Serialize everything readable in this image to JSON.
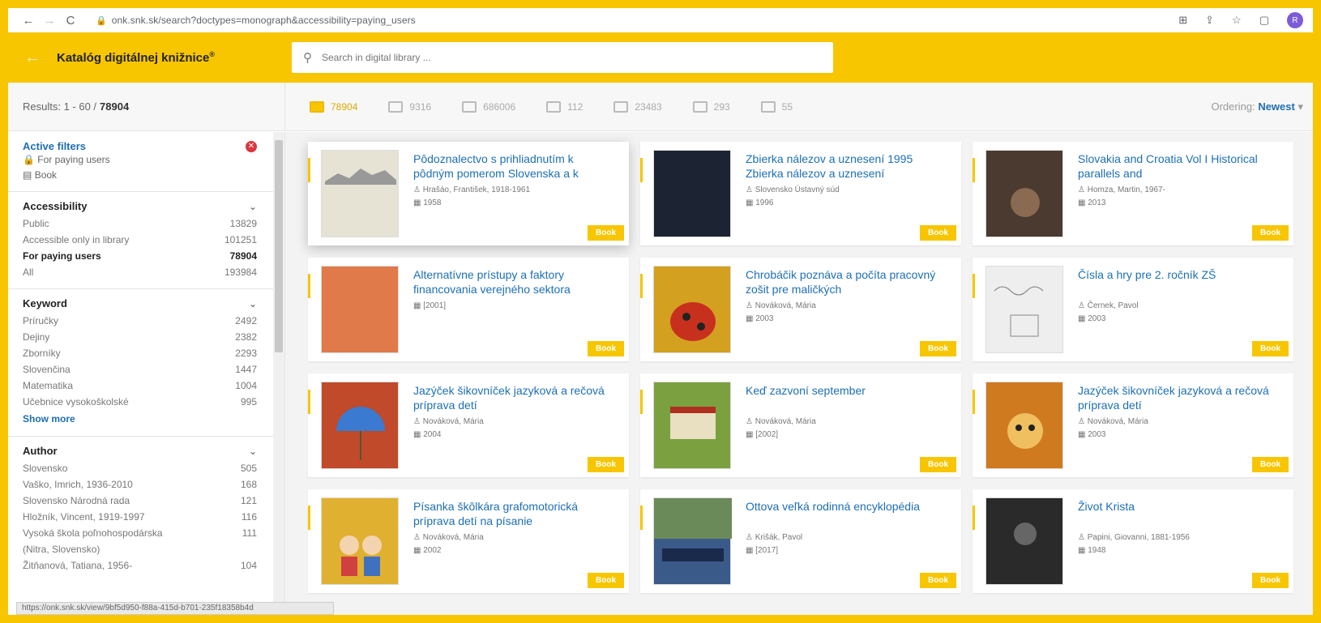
{
  "browser": {
    "url": "onk.snk.sk/search?doctypes=monograph&accessibility=paying_users",
    "avatar": "R",
    "back": "←",
    "forward": "→",
    "reload": "C"
  },
  "header": {
    "title": "Katalóg digitálnej knižnice",
    "sup": "®",
    "search_placeholder": "Search in digital library ..."
  },
  "results": {
    "label": "Results: 1 - 60 /",
    "total": "78904"
  },
  "doctabs": [
    {
      "count": "78904",
      "icon": "book-icon"
    },
    {
      "count": "9316",
      "icon": "periodical-icon"
    },
    {
      "count": "686006",
      "icon": "article-icon"
    },
    {
      "count": "112",
      "icon": "map-icon"
    },
    {
      "count": "23483",
      "icon": "graphic-icon"
    },
    {
      "count": "293",
      "icon": "manuscript-icon"
    },
    {
      "count": "55",
      "icon": "music-icon"
    }
  ],
  "ordering": {
    "label": "Ordering:",
    "value": "Newest"
  },
  "filters": {
    "active": {
      "title": "Active filters",
      "items": [
        "For paying users",
        "Book"
      ]
    },
    "accessibility": {
      "title": "Accessibility",
      "items": [
        {
          "label": "Public",
          "count": "13829"
        },
        {
          "label": "Accessible only in library",
          "count": "101251"
        },
        {
          "label": "For paying users",
          "count": "78904"
        },
        {
          "label": "All",
          "count": "193984"
        }
      ]
    },
    "keyword": {
      "title": "Keyword",
      "items": [
        {
          "label": "Príručky",
          "count": "2492"
        },
        {
          "label": "Dejiny",
          "count": "2382"
        },
        {
          "label": "Zborníky",
          "count": "2293"
        },
        {
          "label": "Slovenčina",
          "count": "1447"
        },
        {
          "label": "Matematika",
          "count": "1004"
        },
        {
          "label": "Učebnice vysokoškolské",
          "count": "995"
        }
      ],
      "show_more": "Show more"
    },
    "author": {
      "title": "Author",
      "items": [
        {
          "label": "Slovensko",
          "count": "505"
        },
        {
          "label": "Vaško, Imrich, 1936-2010",
          "count": "168"
        },
        {
          "label": "Slovensko Národná rada",
          "count": "121"
        },
        {
          "label": "Hložník, Vincent, 1919-1997",
          "count": "116"
        },
        {
          "label": "Vysoká škola poľnohospodárska",
          "count": "111"
        },
        {
          "label": "(Nitra, Slovensko)",
          "count": ""
        },
        {
          "label": "Žitňanová, Tatiana, 1956-",
          "count": "104"
        }
      ]
    }
  },
  "cards": [
    {
      "title": "Pôdoznalectvo s prihliadnutím k pôdným pomerom Slovenska a k",
      "author": "Hrašáo, František, 1918-1961",
      "year": "1958",
      "badge": "Book",
      "thumb": "#d8d4c6"
    },
    {
      "title": "Zbierka nálezov a uznesení 1995 Zbierka nálezov a uznesení",
      "author": "Slovensko Ústavný súd",
      "year": "1996",
      "badge": "Book",
      "thumb": "#1c2433"
    },
    {
      "title": "Slovakia and Croatia Vol I Historical parallels and",
      "author": "Homza, Martin, 1967-",
      "year": "2013",
      "badge": "Book",
      "thumb": "#4a3a30"
    },
    {
      "title": "Alternatívne prístupy a faktory financovania verejného sektora",
      "author": "",
      "year": "[2001]",
      "badge": "Book",
      "thumb": "#e07a4a"
    },
    {
      "title": "Chrobáčik poznáva a počíta pracovný zošit pre maličkých",
      "author": "Nováková, Mária",
      "year": "2003",
      "badge": "Book",
      "thumb": "#d4a020"
    },
    {
      "title": "Čísla a hry pre 2. ročník ZŠ",
      "author": "Černek, Pavol",
      "year": "2003",
      "badge": "Book",
      "thumb": "#e8e8e8"
    },
    {
      "title": "Jazýček šikovníček jazyková a rečová príprava detí",
      "author": "Nováková, Mária",
      "year": "2004",
      "badge": "Book",
      "thumb": "#c04a2a"
    },
    {
      "title": "Keď zazvoní september",
      "author": "Nováková, Mária",
      "year": "[2002]",
      "badge": "Book",
      "thumb": "#7aa040"
    },
    {
      "title": "Jazýček šikovníček jazyková a rečová príprava detí",
      "author": "Nováková, Mária",
      "year": "2003",
      "badge": "Book",
      "thumb": "#d07a20"
    },
    {
      "title": "Písanka škôlkára grafomotorická príprava detí na písanie",
      "author": "Nováková, Mária",
      "year": "2002",
      "badge": "Book",
      "thumb": "#e0b030"
    },
    {
      "title": "Ottova veľká rodinná encyklopédia",
      "author": "Krišák, Pavol",
      "year": "[2017]",
      "badge": "Book",
      "thumb": "#3a5a8a"
    },
    {
      "title": "Život Krista",
      "author": "Papini, Giovanni, 1881-1956",
      "year": "1948",
      "badge": "Book",
      "thumb": "#2a2a2a"
    }
  ],
  "status_url": "https://onk.snk.sk/view/9bf5d950-f88a-415d-b701-235f18358b4d"
}
